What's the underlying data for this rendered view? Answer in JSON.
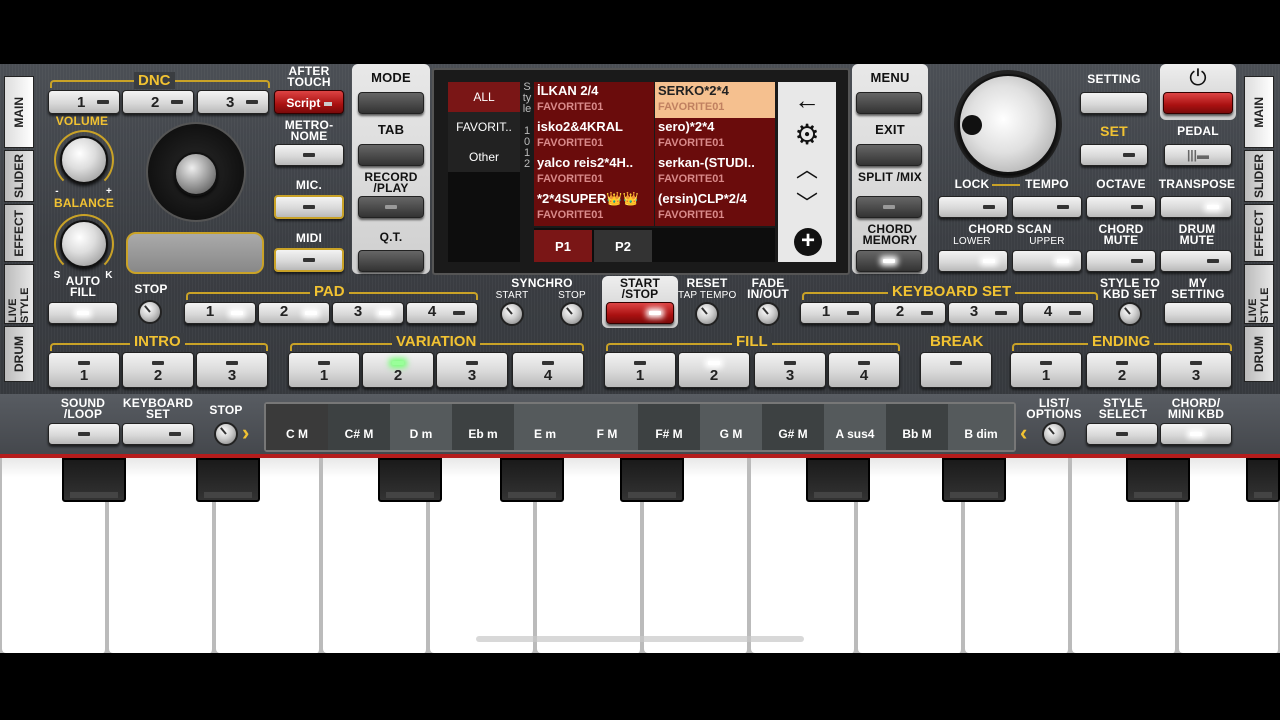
{
  "tabs_left": [
    "MAIN",
    "SLIDER",
    "EFFECT",
    "LIVE STYLE",
    "DRUM"
  ],
  "tabs_right": [
    "MAIN",
    "SLIDER",
    "EFFECT",
    "LIVE STYLE",
    "DRUM"
  ],
  "dnc": {
    "title": "DNC",
    "buttons": [
      "1",
      "2",
      "3"
    ],
    "script": "Script"
  },
  "labels": {
    "after_touch": "AFTER TOUCH",
    "metronome": "METRO- NOME",
    "mic": "MIC.",
    "midi": "MIDI",
    "volume": "VOLUME",
    "balance": "BALANCE",
    "s": "S",
    "k": "K",
    "minus": "-",
    "plus": "+",
    "auto_fill": "AUTO FILL",
    "stop": "STOP",
    "pad": "PAD",
    "synchro": "SYNCHRO",
    "synchro_start": "START",
    "synchro_stop": "STOP",
    "start_stop": "START /STOP",
    "reset": "RESET",
    "tap_tempo": "TAP TEMPO",
    "fade": "FADE IN/OUT",
    "keyboard_set": "KEYBOARD SET",
    "style_to_kbd": "STYLE TO KBD SET",
    "my_setting": "MY SETTING",
    "intro": "INTRO",
    "variation": "VARIATION",
    "fill": "FILL",
    "break": "BREAK",
    "ending": "ENDING",
    "sound_loop": "SOUND /LOOP",
    "keyboard_set2": "KEYBOARD SET",
    "stop2": "STOP",
    "list_options": "LIST/ OPTIONS",
    "style_select": "STYLE SELECT",
    "chord_mini": "CHORD/ MINI KBD",
    "lock": "LOCK",
    "tempo": "TEMPO",
    "octave": "OCTAVE",
    "transpose": "TRANSPOSE",
    "chord_scan": "CHORD SCAN",
    "lower": "LOWER",
    "upper": "UPPER",
    "chord_mute": "CHORD MUTE",
    "drum_mute": "DRUM MUTE",
    "setting": "SETTING",
    "set": "SET",
    "pedal": "PEDAL"
  },
  "center_buttons": {
    "mode": "MODE",
    "tab": "TAB",
    "record": "RECORD /PLAY",
    "qt": "Q.T.",
    "menu": "MENU",
    "exit": "EXIT",
    "split": "SPLIT /MIX",
    "chord_memory": "CHORD MEMORY"
  },
  "screen": {
    "filters": [
      "ALL",
      "FAVORIT..",
      "Other"
    ],
    "side_label": "Style",
    "page_indicator": "10 12",
    "styles": [
      {
        "name": "İLKAN 2/4",
        "fav": "FAVORITE01"
      },
      {
        "name": "SERKO*2*4",
        "fav": "FAVORITE01"
      },
      {
        "name": "isko2&4KRAL",
        "fav": "FAVORITE01"
      },
      {
        "name": "sero)*2*4",
        "fav": "FAVORITE01"
      },
      {
        "name": "yalco reis2*4H..",
        "fav": "FAVORITE01"
      },
      {
        "name": "serkan-(STUDI..",
        "fav": "FAVORITE01"
      },
      {
        "name": "*2*4SUPER👑👑",
        "fav": "FAVORITE01"
      },
      {
        "name": "(ersin)CLP*2/4",
        "fav": "FAVORITE01"
      }
    ],
    "pages": [
      "P1",
      "P2"
    ]
  },
  "pad": [
    "1",
    "2",
    "3",
    "4"
  ],
  "intro": [
    "1",
    "2",
    "3"
  ],
  "variation": [
    "1",
    "2",
    "3",
    "4"
  ],
  "fill": [
    "1",
    "2",
    "3",
    "4"
  ],
  "ending": [
    "1",
    "2",
    "3"
  ],
  "keyboard_set": [
    "1",
    "2",
    "3",
    "4"
  ],
  "chords": [
    "C M",
    "C# M",
    "D m",
    "Eb m",
    "E m",
    "F M",
    "F# M",
    "G M",
    "G# M",
    "A sus4",
    "Bb M",
    "B dim"
  ]
}
